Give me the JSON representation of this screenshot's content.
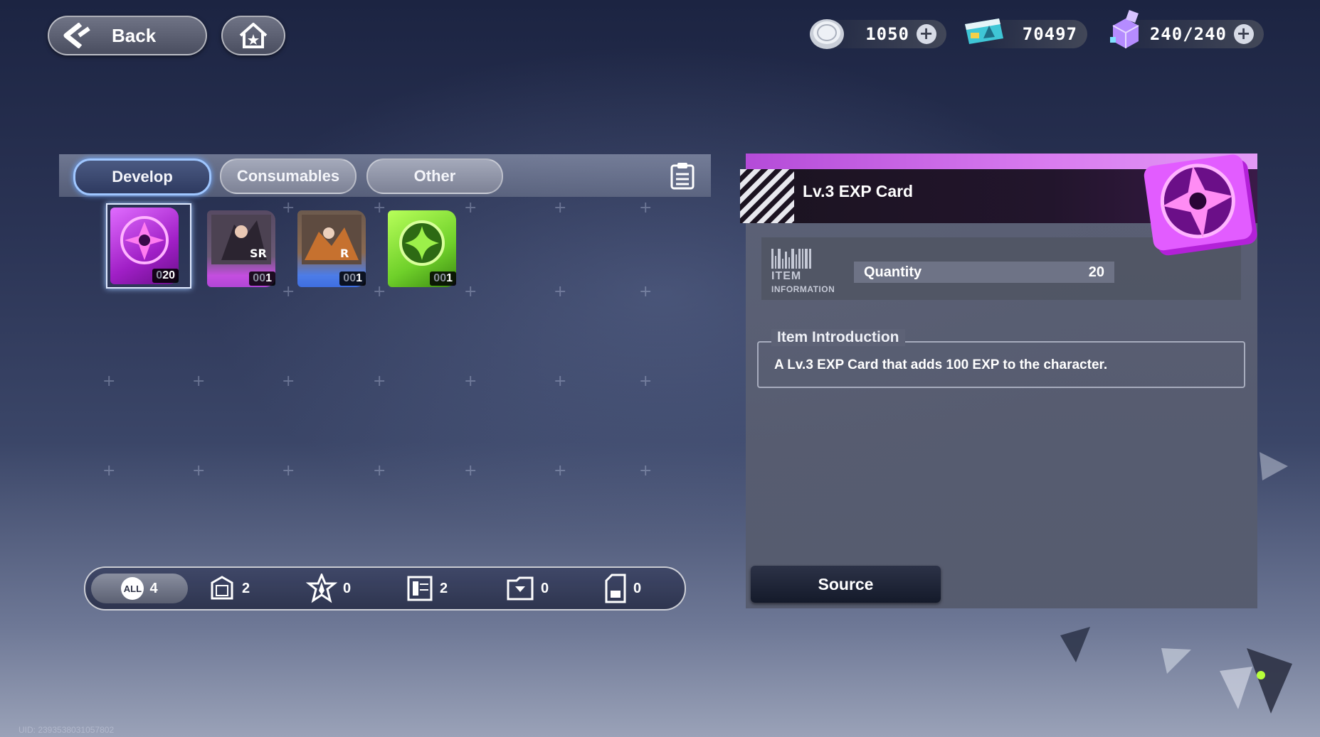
{
  "header": {
    "back_label": "Back",
    "currencies": [
      {
        "icon": "silver-coin-icon",
        "value": "1050",
        "has_plus": true
      },
      {
        "icon": "world-ticket-icon",
        "value": "70497",
        "has_plus": false
      },
      {
        "icon": "crystal-stamina-icon",
        "value": "240/240",
        "has_plus": true
      }
    ]
  },
  "inventory": {
    "tabs": [
      {
        "label": "Develop",
        "active": true
      },
      {
        "label": "Consumables",
        "active": false
      },
      {
        "label": "Other",
        "active": false
      }
    ],
    "items": [
      {
        "name": "Lv.3 EXP Card",
        "count_dim": "0",
        "count": "20",
        "selected": true,
        "color": "#c83fe6"
      },
      {
        "name": "character-card-purple",
        "count_dim": "00",
        "count": "1",
        "selected": false,
        "color": "#b146d6"
      },
      {
        "name": "character-card-blue",
        "count_dim": "00",
        "count": "1",
        "selected": false,
        "color": "#3f6ee0"
      },
      {
        "name": "green-token-card",
        "count_dim": "00",
        "count": "1",
        "selected": false,
        "color": "#6fd02a"
      }
    ],
    "filters": [
      {
        "icon": "all-icon",
        "label": "ALL",
        "count": "4"
      },
      {
        "icon": "card-box-icon",
        "count": "2"
      },
      {
        "icon": "star-emblem-icon",
        "count": "0"
      },
      {
        "icon": "card-frame-icon",
        "count": "2"
      },
      {
        "icon": "folder-icon",
        "count": "0"
      },
      {
        "icon": "sd-card-icon",
        "count": "0"
      }
    ]
  },
  "detail": {
    "item_name": "Lv.3 EXP Card",
    "info_label_1": "ITEM",
    "info_label_2": "INFORMATION",
    "quantity_label": "Quantity",
    "quantity_value": "20",
    "intro_title": "Item Introduction",
    "intro_text": "A Lv.3 EXP Card that adds 100 EXP to the character.",
    "source_label": "Source"
  },
  "uid": "UID: 2393538031057802"
}
